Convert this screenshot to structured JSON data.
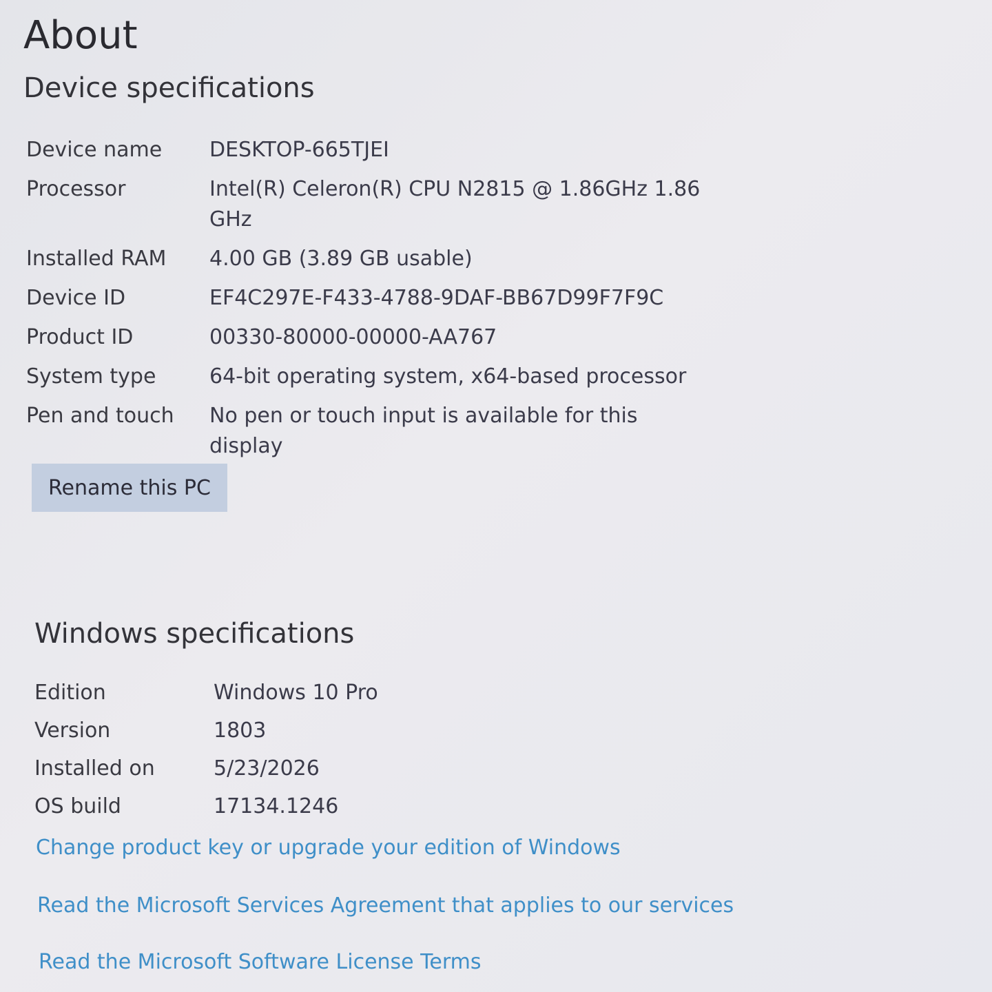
{
  "page": {
    "title": "About"
  },
  "device_specs": {
    "heading": "Device specifications",
    "rows": [
      {
        "label": "Device name",
        "value": "DESKTOP-665TJEI"
      },
      {
        "label": "Processor",
        "value": "Intel(R) Celeron(R) CPU  N2815  @ 1.86GHz   1.86 GHz"
      },
      {
        "label": "Installed RAM",
        "value": "4.00 GB (3.89 GB usable)"
      },
      {
        "label": "Device ID",
        "value": "EF4C297E-F433-4788-9DAF-BB67D99F7F9C"
      },
      {
        "label": "Product ID",
        "value": "00330-80000-00000-AA767"
      },
      {
        "label": "System type",
        "value": "64-bit operating system, x64-based processor"
      },
      {
        "label": "Pen and touch",
        "value": "No pen or touch input is available for this display"
      }
    ],
    "rename_button_label": "Rename this PC"
  },
  "windows_specs": {
    "heading": "Windows specifications",
    "rows": [
      {
        "label": "Edition",
        "value": "Windows 10 Pro"
      },
      {
        "label": "Version",
        "value": "1803"
      },
      {
        "label": "Installed on",
        "value": "5/23/2026"
      },
      {
        "label": "OS build",
        "value": "17134.1246"
      }
    ]
  },
  "links": {
    "product_key": "Change product key or upgrade your edition of Windows",
    "services_agreement": "Read the Microsoft Services Agreement that applies to our services",
    "license_terms": "Read the Microsoft Software License Terms"
  },
  "colors": {
    "link": "#3f8fc8",
    "button_bg": "#c3cee0",
    "background": "#e6e7ec"
  }
}
